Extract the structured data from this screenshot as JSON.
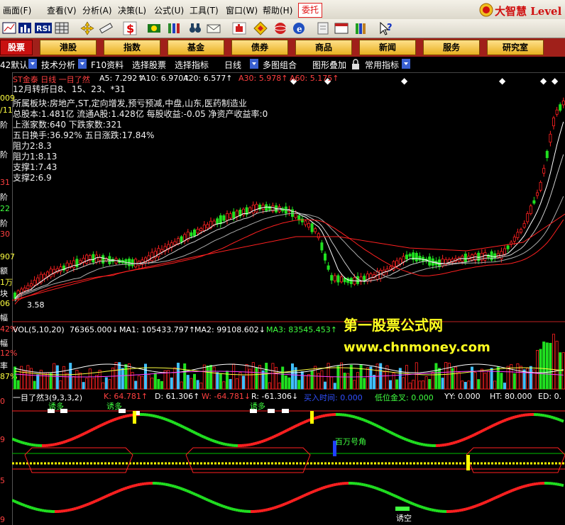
{
  "menu": [
    "画面(F)",
    "查看(V)",
    "分析(A)",
    "决策(L)",
    "公式(U)",
    "工具(T)",
    "窗口(W)",
    "帮助(H)"
  ],
  "order_button": "委托",
  "brand": "大智慧 Level",
  "toolbar_icons": [
    "chart-icon",
    "bar-stats-icon",
    "rsi-icon",
    "grid-icon",
    "move-icon",
    "ruler-icon",
    "dollar-icon",
    "money-icon",
    "columns-icon",
    "binoculars-icon",
    "mail-icon",
    "hand-icon",
    "diamond-icon",
    "globe-icon",
    "info-icon",
    "page-icon",
    "window-icon",
    "books-icon",
    "help-icon"
  ],
  "toolbar_rsi": "RSI",
  "categories": [
    "股票",
    "港股",
    "指数",
    "基金",
    "债券",
    "商品",
    "新闻",
    "服务",
    "研究室"
  ],
  "funcbar": [
    "42默认",
    "技术分析",
    "F10资料",
    "选择股票",
    "选择指标",
    "日线",
    "多图组合",
    "图形叠加",
    "常用指标"
  ],
  "left_strip": [
    "009",
    "/11",
    "阶",
    "阶",
    "31",
    "阶",
    "22",
    "阶",
    "30",
    "907",
    "额",
    "1万",
    "块",
    "06",
    "幅",
    "42%",
    "幅",
    "12%",
    "率",
    "87%",
    "0",
    "9",
    "5",
    "9"
  ],
  "stock": {
    "title": "ST金泰 日线  一目了然",
    "ma": [
      {
        "label": "A5: 7.292↑",
        "color": "#ffffff"
      },
      {
        "label": "A10: 6.970↑",
        "color": "#ffffff"
      },
      {
        "label": "A20: 6.577↑",
        "color": "#ffffff"
      },
      {
        "label": "A30: 5.978↑",
        "color": "#ff3030"
      },
      {
        "label": "A60: 5.175↑",
        "color": "#ff3030"
      }
    ],
    "turn": "12月转折日8、15、23、*31",
    "info_lines": [
      "所属板块:房地产,ST,定向增发,预亏预减,中盘,山东,医药制造业",
      "总股本:1.481亿  流通A股:1.428亿  每股收益:-0.05 净资产收益率:0",
      "上涨家数:640      下跌家数:321",
      "五日换手:36.92%    五日涨跌:17.84%",
      "阻力2:8.3",
      "阻力1:8.13",
      "支撑1:7.43",
      "支撑2:6.9"
    ],
    "low_label": "3.58"
  },
  "watermark": {
    "title": "第一股票公式网",
    "url": "www.chnmoney.com"
  },
  "volume": {
    "title": "VOL(5,10,20)",
    "value": "76365.000↓",
    "ma1": "MA1: 105433.797↑",
    "ma2": "MA2: 99108.602↓",
    "ma3": "MA3: 83545.453↑"
  },
  "indicator": {
    "title": "一目了然3(9,3,3,2)",
    "k": "K: 64.781↑",
    "d": "D: 61.306↑",
    "w": "W: -64.781↓",
    "r": "R: -61.306↓",
    "buy_time": "买入时间: 0.000",
    "gold": "低位金叉: 0.000",
    "yy": "YY: 0.000",
    "ht": "HT: 80.000",
    "ed": "ED: 0.",
    "annotations": [
      "诱多",
      "诱多",
      "诱多",
      "百万号角",
      "诱空"
    ]
  },
  "colors": {
    "up": "#ff2020",
    "down": "#20e020",
    "accent": "#e8b020",
    "bg": "#000000"
  }
}
